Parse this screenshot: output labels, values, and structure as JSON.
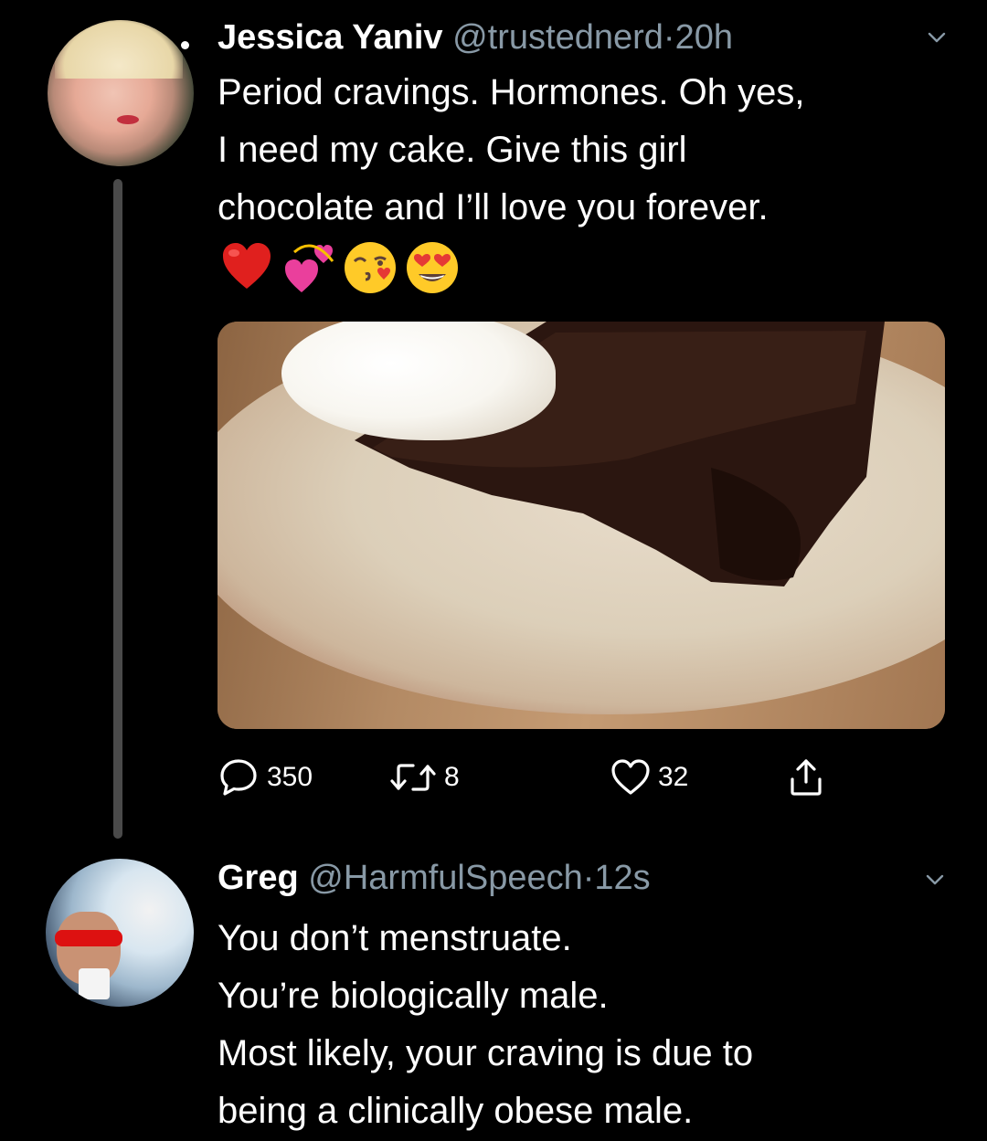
{
  "tweets": [
    {
      "display_name": "Jessica Yaniv",
      "handle": "@trustednerd",
      "separator": "·",
      "time": "20h",
      "text_lines": [
        "Period cravings. Hormones. Oh yes,",
        "I need my cake. Give this girl",
        "chocolate and I’ll love you forever."
      ],
      "emojis": [
        "red-heart",
        "revolving-hearts",
        "face-blowing-kiss",
        "smiling-face-with-heart-eyes"
      ],
      "stats": {
        "replies": "350",
        "retweets": "8",
        "likes": "32"
      }
    },
    {
      "display_name": "Greg",
      "handle": "@HarmfulSpeech",
      "separator": "·",
      "time": "12s",
      "text_lines": [
        "You don’t menstruate.",
        "You’re biologically male.",
        "Most likely, your craving is due to",
        "being a clinically obese male."
      ]
    }
  ],
  "theme": {
    "background": "#000000",
    "text": "#ffffff",
    "secondary_text": "#8899a6",
    "thread_line": "#4a4a4a"
  }
}
